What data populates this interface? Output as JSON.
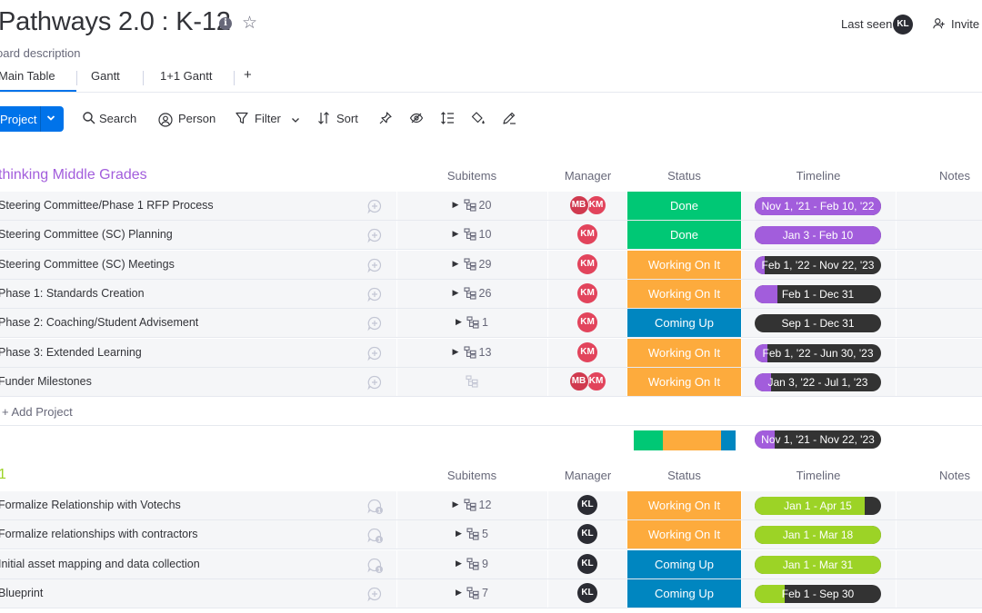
{
  "header": {
    "title": "Pathways 2.0 : K-12",
    "board_description": "oard description",
    "last_seen_label": "Last seen",
    "last_seen_avatar": "KL",
    "invite_label": "Invite"
  },
  "tabs": [
    {
      "label": "Main Table",
      "active": true
    },
    {
      "label": "Gantt"
    },
    {
      "label": "1+1 Gantt"
    },
    {
      "label": "+"
    }
  ],
  "toolbar": {
    "new_item_label": "Project",
    "search_label": "Search",
    "person_label": "Person",
    "filter_label": "Filter",
    "sort_label": "Sort"
  },
  "columns": {
    "subitems": "Subitems",
    "manager": "Manager",
    "status": "Status",
    "timeline": "Timeline",
    "notes": "Notes"
  },
  "colors": {
    "done": "#00c875",
    "working": "#fdab3d",
    "coming_up": "#0086c0",
    "purple": "#a25ddc",
    "lime": "#9cd326",
    "timeline_dark": "#333333",
    "group1": "#a25ddc",
    "group2": "#9cd326"
  },
  "groups": [
    {
      "title": "thinking Middle Grades",
      "color": "#a25ddc",
      "add_label": "+ Add Project",
      "rows": [
        {
          "name": "Steering Committee/Phase 1 RFP Process",
          "subitems": "20",
          "managers": [
            "MB",
            "KM"
          ],
          "status": "Done",
          "status_color": "#00c875",
          "timeline": "Nov 1, '21 - Feb 10, '22",
          "progress": 1.0,
          "fill": "#a25ddc",
          "updates": ""
        },
        {
          "name": "Steering Committee (SC) Planning",
          "subitems": "10",
          "managers": [
            "KM"
          ],
          "status": "Done",
          "status_color": "#00c875",
          "timeline": "Jan 3 - Feb 10",
          "progress": 1.0,
          "fill": "#a25ddc",
          "updates": ""
        },
        {
          "name": "Steering Committee (SC) Meetings",
          "subitems": "29",
          "managers": [
            "KM"
          ],
          "status": "Working On It",
          "status_color": "#fdab3d",
          "timeline": "Feb 1, '22 - Nov 22, '23",
          "progress": 0.08,
          "fill": "#a25ddc",
          "updates": ""
        },
        {
          "name": "Phase 1: Standards Creation",
          "subitems": "26",
          "managers": [
            "KM"
          ],
          "status": "Working On It",
          "status_color": "#fdab3d",
          "timeline": "Feb 1 - Dec 31",
          "progress": 0.18,
          "fill": "#a25ddc",
          "updates": ""
        },
        {
          "name": "Phase 2: Coaching/Student Advisement",
          "subitems": "1",
          "managers": [
            "KM"
          ],
          "status": "Coming Up",
          "status_color": "#0086c0",
          "timeline": "Sep 1 - Dec 31",
          "progress": 0.0,
          "fill": "#a25ddc",
          "updates": ""
        },
        {
          "name": "Phase 3: Extended Learning",
          "subitems": "13",
          "managers": [
            "KM"
          ],
          "status": "Working On It",
          "status_color": "#fdab3d",
          "timeline": "Feb 1, '22 - Jun 30, '23",
          "progress": 0.1,
          "fill": "#a25ddc",
          "updates": ""
        },
        {
          "name": "Funder Milestones",
          "subitems": "",
          "managers": [
            "MB",
            "KM"
          ],
          "status": "Working On It",
          "status_color": "#fdab3d",
          "timeline": "Jan 3, '22 - Jul 1, '23",
          "progress": 0.13,
          "fill": "#a25ddc",
          "updates": ""
        }
      ],
      "summary": {
        "segments": [
          {
            "color": "#00c875",
            "fraction": 0.29
          },
          {
            "color": "#fdab3d",
            "fraction": 0.57
          },
          {
            "color": "#0086c0",
            "fraction": 0.14
          }
        ],
        "timeline": "Nov 1, '21 - Nov 22, '23",
        "progress": 0.16
      }
    },
    {
      "title": "1",
      "color": "#9cd326",
      "rows": [
        {
          "name": "Formalize Relationship with Votechs",
          "subitems": "12",
          "managers": [
            "KL"
          ],
          "status": "Working On It",
          "status_color": "#fdab3d",
          "timeline": "Jan 1 - Apr 15",
          "progress": 0.87,
          "fill": "#9cd326",
          "updates": "1"
        },
        {
          "name": "Formalize relationships with contractors",
          "subitems": "5",
          "managers": [
            "KL"
          ],
          "status": "Working On It",
          "status_color": "#fdab3d",
          "timeline": "Jan 1 - Mar 18",
          "progress": 1.0,
          "fill": "#9cd326",
          "updates": "1"
        },
        {
          "name": "Initial asset mapping and data collection",
          "subitems": "9",
          "managers": [
            "KL"
          ],
          "status": "Coming Up",
          "status_color": "#0086c0",
          "timeline": "Jan 1 - Mar 31",
          "progress": 1.0,
          "fill": "#9cd326",
          "updates": "1"
        },
        {
          "name": "Blueprint",
          "subitems": "7",
          "managers": [
            "KL"
          ],
          "status": "Coming Up",
          "status_color": "#0086c0",
          "timeline": "Feb 1 - Sep 30",
          "progress": 0.24,
          "fill": "#9cd326",
          "updates": ""
        }
      ]
    }
  ]
}
